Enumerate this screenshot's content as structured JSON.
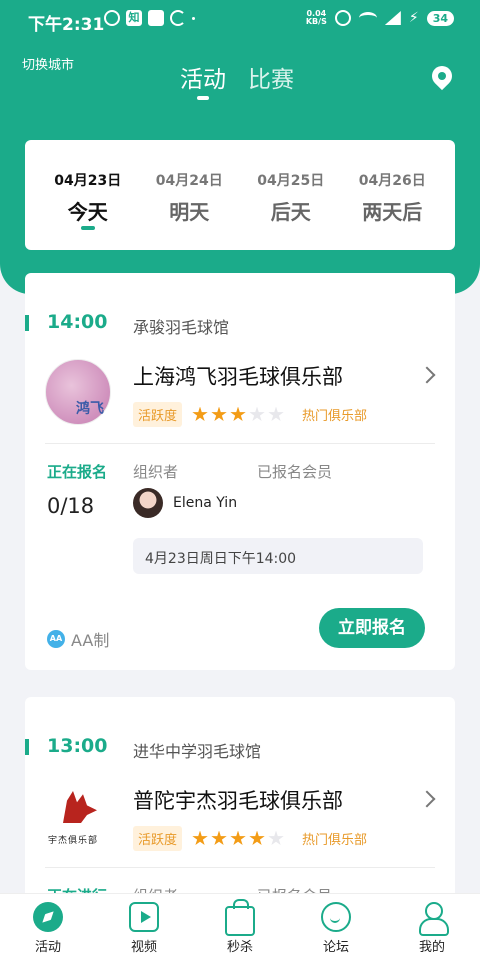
{
  "status_bar": {
    "time": "下午2:31",
    "net_speed_value": "0.04",
    "net_speed_unit": "KB/S",
    "battery": "34",
    "app_badge": "知"
  },
  "header": {
    "city_label": "切换城市",
    "tabs": [
      {
        "label": "活动",
        "active": true
      },
      {
        "label": "比赛",
        "active": false
      }
    ]
  },
  "dates": [
    {
      "date": "04月23日",
      "day": "今天",
      "active": true
    },
    {
      "date": "04月24日",
      "day": "明天",
      "active": false
    },
    {
      "date": "04月25日",
      "day": "后天",
      "active": false
    },
    {
      "date": "04月26日",
      "day": "两天后",
      "active": false
    }
  ],
  "activities": [
    {
      "time": "14:00",
      "venue": "承骏羽毛球馆",
      "logo_text": "鸿飞",
      "club": "上海鸿飞羽毛球俱乐部",
      "activity_tag": "活跃度",
      "stars": 3,
      "stars_max": 5,
      "hot_tag": "热门俱乐部",
      "status": "正在报名",
      "count": "0/18",
      "organizer_label": "组织者",
      "members_label": "已报名会员",
      "organizer_name": "Elena Yin",
      "datetime": "4月23日周日下午14:00",
      "fee_icon": "AA",
      "fee_type": "AA制",
      "signup_label": "立即报名"
    },
    {
      "time": "13:00",
      "venue": "进华中学羽毛球馆",
      "logo_text": "宇杰俱乐部",
      "club": "普陀宇杰羽毛球俱乐部",
      "activity_tag": "活跃度",
      "stars": 4,
      "stars_max": 5,
      "hot_tag": "热门俱乐部",
      "status": "正在进行",
      "organizer_label": "组织者",
      "members_label": "已报名会员"
    }
  ],
  "bottom_nav": [
    {
      "label": "活动",
      "icon": "compass-icon",
      "active": true
    },
    {
      "label": "视频",
      "icon": "video-icon",
      "active": false
    },
    {
      "label": "秒杀",
      "icon": "bag-icon",
      "active": false
    },
    {
      "label": "论坛",
      "icon": "chat-icon",
      "active": false
    },
    {
      "label": "我的",
      "icon": "user-icon",
      "active": false
    }
  ],
  "colors": {
    "primary": "#1bab8a",
    "star": "#f39c16",
    "tag_text": "#e89a2a",
    "tag_bg": "#fff1dc",
    "background": "#f2f3f7"
  }
}
